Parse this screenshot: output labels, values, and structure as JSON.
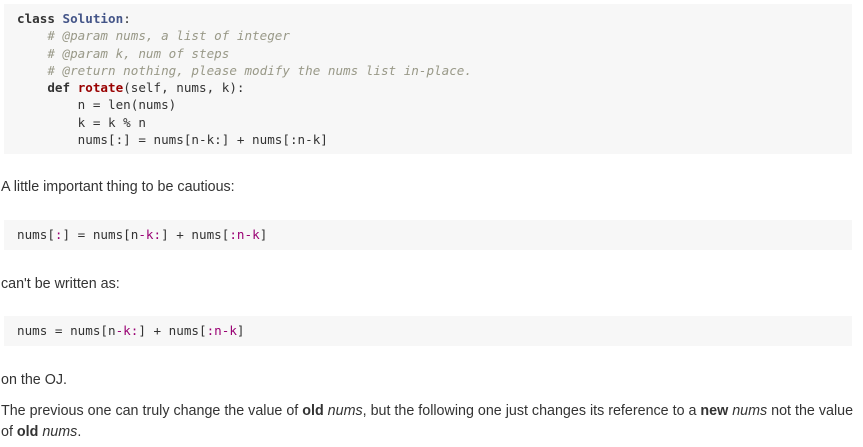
{
  "code_block_1": {
    "lines": [
      {
        "kw": "class",
        "name": "Solution",
        "rest": ":"
      },
      {
        "indent": "    ",
        "comment": "# @param nums, a list of integer"
      },
      {
        "indent": "    ",
        "comment": "# @param k, num of steps"
      },
      {
        "indent": "    ",
        "comment": "# @return nothing, please modify the nums list in-place."
      },
      {
        "indent": "    ",
        "kw": "def",
        "name": "rotate",
        "rest": "(self, nums, k):"
      },
      {
        "indent": "        ",
        "text": "n = len(nums)"
      },
      {
        "indent": "        ",
        "text": "k = k % n"
      },
      {
        "indent": "        ",
        "text": "nums[:] = nums[n-k:] + nums[:n-k]"
      }
    ]
  },
  "para_1": "A little important thing to be cautious:",
  "code_block_2": {
    "line": {
      "a": "nums[",
      "b": ":",
      "c": "] = nums[n",
      "d": "-k:",
      "e": "] + nums[",
      "f": ":n-k",
      "g": "]"
    }
  },
  "para_2": "can't be written as:",
  "code_block_3": {
    "line": {
      "a": "nums = nums[n",
      "b": "-k:",
      "c": "] + nums[",
      "d": ":n-k",
      "e": "]"
    }
  },
  "para_3": "on the OJ.",
  "para_4": {
    "t1": "The previous one can truly change the value of ",
    "b1": "old",
    "t2": " ",
    "i1": "nums",
    "t3": ", but the following one just changes its reference to a ",
    "b2": "new",
    "t4": " ",
    "i2": "nums",
    "t5": " not the value of ",
    "b3": "old",
    "t6": " ",
    "i3": "nums",
    "t7": "."
  }
}
